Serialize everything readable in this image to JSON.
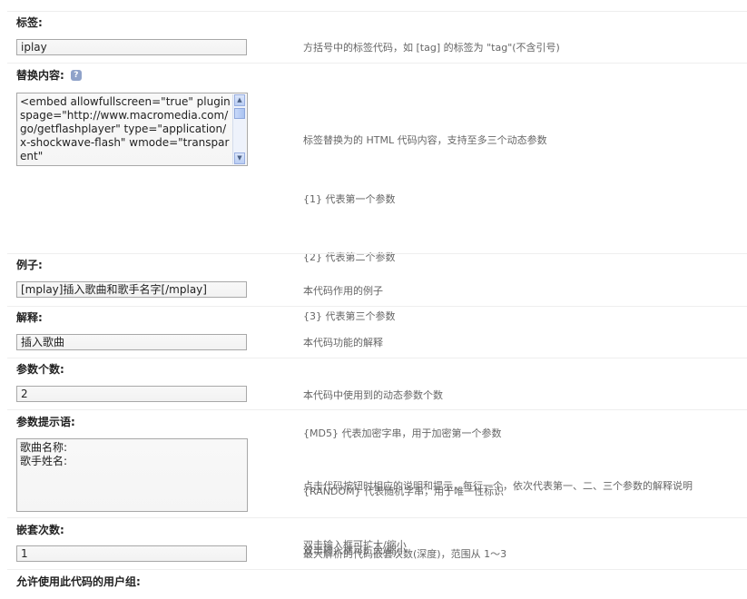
{
  "fields": {
    "tag": {
      "label": "标签:",
      "value": "iplay",
      "desc": "方括号中的标签代码，如 [tag] 的标签为 \"tag\"(不含引号)"
    },
    "replace": {
      "label": "替换内容:",
      "help_icon": "?",
      "value": "<embed allowfullscreen=\"true\" pluginspage=\"http://www.macromedia.com/go/getflashplayer\" type=\"application/x-shockwave-flash\" wmode=\"transparent\"",
      "desc": [
        "标签替换为的 HTML 代码内容，支持至多三个动态参数",
        "{1} 代表第一个参数",
        "{2} 代表第二个参数",
        "{3} 代表第三个参数",
        "",
        "{MD5} 代表加密字串，用于加密第一个参数",
        "{RANDOM} 代表随机字串，用于唯一性标识",
        "双击输入框可扩大/缩小"
      ]
    },
    "example": {
      "label": "例子:",
      "value": "[mplay]插入歌曲和歌手名字[/mplay]",
      "desc": "本代码作用的例子"
    },
    "explanation": {
      "label": "解释:",
      "value": "插入歌曲",
      "desc": "本代码功能的解释"
    },
    "param_count": {
      "label": "参数个数:",
      "value": "2",
      "desc": "本代码中使用到的动态参数个数"
    },
    "param_prompt": {
      "label": "参数提示语:",
      "value": "歌曲名称:\n歌手姓名:",
      "desc": [
        "点击代码按钮时相应的说明和提示，每行一个，依次代表第一、二、三个参数的解释说明",
        "双击输入框可扩大/缩小"
      ]
    },
    "nest_count": {
      "label": "嵌套次数:",
      "value": "1",
      "desc": "最大解析的代码嵌套次数(深度)，范围从 1～3"
    },
    "user_groups": {
      "label": "允许使用此代码的用户组:"
    }
  }
}
